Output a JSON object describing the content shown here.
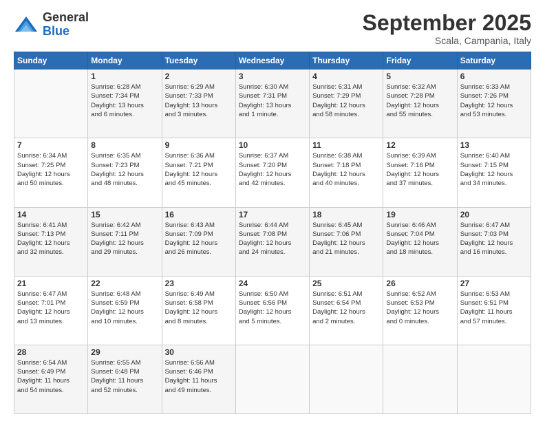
{
  "logo": {
    "general": "General",
    "blue": "Blue"
  },
  "header": {
    "month": "September 2025",
    "location": "Scala, Campania, Italy"
  },
  "days_of_week": [
    "Sunday",
    "Monday",
    "Tuesday",
    "Wednesday",
    "Thursday",
    "Friday",
    "Saturday"
  ],
  "weeks": [
    [
      {
        "day": "",
        "info": ""
      },
      {
        "day": "1",
        "info": "Sunrise: 6:28 AM\nSunset: 7:34 PM\nDaylight: 13 hours\nand 6 minutes."
      },
      {
        "day": "2",
        "info": "Sunrise: 6:29 AM\nSunset: 7:33 PM\nDaylight: 13 hours\nand 3 minutes."
      },
      {
        "day": "3",
        "info": "Sunrise: 6:30 AM\nSunset: 7:31 PM\nDaylight: 13 hours\nand 1 minute."
      },
      {
        "day": "4",
        "info": "Sunrise: 6:31 AM\nSunset: 7:29 PM\nDaylight: 12 hours\nand 58 minutes."
      },
      {
        "day": "5",
        "info": "Sunrise: 6:32 AM\nSunset: 7:28 PM\nDaylight: 12 hours\nand 55 minutes."
      },
      {
        "day": "6",
        "info": "Sunrise: 6:33 AM\nSunset: 7:26 PM\nDaylight: 12 hours\nand 53 minutes."
      }
    ],
    [
      {
        "day": "7",
        "info": "Sunrise: 6:34 AM\nSunset: 7:25 PM\nDaylight: 12 hours\nand 50 minutes."
      },
      {
        "day": "8",
        "info": "Sunrise: 6:35 AM\nSunset: 7:23 PM\nDaylight: 12 hours\nand 48 minutes."
      },
      {
        "day": "9",
        "info": "Sunrise: 6:36 AM\nSunset: 7:21 PM\nDaylight: 12 hours\nand 45 minutes."
      },
      {
        "day": "10",
        "info": "Sunrise: 6:37 AM\nSunset: 7:20 PM\nDaylight: 12 hours\nand 42 minutes."
      },
      {
        "day": "11",
        "info": "Sunrise: 6:38 AM\nSunset: 7:18 PM\nDaylight: 12 hours\nand 40 minutes."
      },
      {
        "day": "12",
        "info": "Sunrise: 6:39 AM\nSunset: 7:16 PM\nDaylight: 12 hours\nand 37 minutes."
      },
      {
        "day": "13",
        "info": "Sunrise: 6:40 AM\nSunset: 7:15 PM\nDaylight: 12 hours\nand 34 minutes."
      }
    ],
    [
      {
        "day": "14",
        "info": "Sunrise: 6:41 AM\nSunset: 7:13 PM\nDaylight: 12 hours\nand 32 minutes."
      },
      {
        "day": "15",
        "info": "Sunrise: 6:42 AM\nSunset: 7:11 PM\nDaylight: 12 hours\nand 29 minutes."
      },
      {
        "day": "16",
        "info": "Sunrise: 6:43 AM\nSunset: 7:09 PM\nDaylight: 12 hours\nand 26 minutes."
      },
      {
        "day": "17",
        "info": "Sunrise: 6:44 AM\nSunset: 7:08 PM\nDaylight: 12 hours\nand 24 minutes."
      },
      {
        "day": "18",
        "info": "Sunrise: 6:45 AM\nSunset: 7:06 PM\nDaylight: 12 hours\nand 21 minutes."
      },
      {
        "day": "19",
        "info": "Sunrise: 6:46 AM\nSunset: 7:04 PM\nDaylight: 12 hours\nand 18 minutes."
      },
      {
        "day": "20",
        "info": "Sunrise: 6:47 AM\nSunset: 7:03 PM\nDaylight: 12 hours\nand 16 minutes."
      }
    ],
    [
      {
        "day": "21",
        "info": "Sunrise: 6:47 AM\nSunset: 7:01 PM\nDaylight: 12 hours\nand 13 minutes."
      },
      {
        "day": "22",
        "info": "Sunrise: 6:48 AM\nSunset: 6:59 PM\nDaylight: 12 hours\nand 10 minutes."
      },
      {
        "day": "23",
        "info": "Sunrise: 6:49 AM\nSunset: 6:58 PM\nDaylight: 12 hours\nand 8 minutes."
      },
      {
        "day": "24",
        "info": "Sunrise: 6:50 AM\nSunset: 6:56 PM\nDaylight: 12 hours\nand 5 minutes."
      },
      {
        "day": "25",
        "info": "Sunrise: 6:51 AM\nSunset: 6:54 PM\nDaylight: 12 hours\nand 2 minutes."
      },
      {
        "day": "26",
        "info": "Sunrise: 6:52 AM\nSunset: 6:53 PM\nDaylight: 12 hours\nand 0 minutes."
      },
      {
        "day": "27",
        "info": "Sunrise: 6:53 AM\nSunset: 6:51 PM\nDaylight: 11 hours\nand 57 minutes."
      }
    ],
    [
      {
        "day": "28",
        "info": "Sunrise: 6:54 AM\nSunset: 6:49 PM\nDaylight: 11 hours\nand 54 minutes."
      },
      {
        "day": "29",
        "info": "Sunrise: 6:55 AM\nSunset: 6:48 PM\nDaylight: 11 hours\nand 52 minutes."
      },
      {
        "day": "30",
        "info": "Sunrise: 6:56 AM\nSunset: 6:46 PM\nDaylight: 11 hours\nand 49 minutes."
      },
      {
        "day": "",
        "info": ""
      },
      {
        "day": "",
        "info": ""
      },
      {
        "day": "",
        "info": ""
      },
      {
        "day": "",
        "info": ""
      }
    ]
  ]
}
